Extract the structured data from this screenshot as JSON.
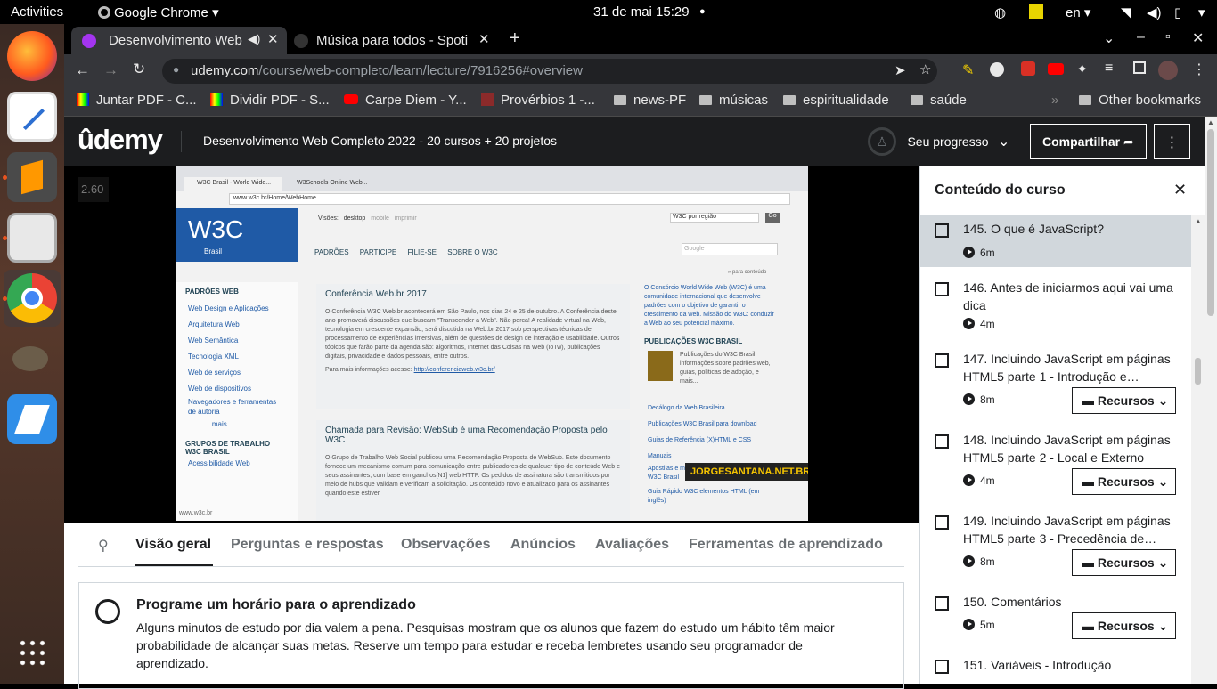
{
  "system": {
    "activities": "Activities",
    "app": "Google Chrome",
    "datetime": "31 de mai  15:29",
    "lang": "en"
  },
  "tabs": [
    {
      "title": "Desenvolvimento Web",
      "active": true
    },
    {
      "title": "Música para todos - Spoti",
      "active": false
    }
  ],
  "omnibox": {
    "host": "udemy.com",
    "path": "/course/web-completo/learn/lecture/7916256#overview"
  },
  "bookmarks": [
    "Juntar PDF - C...",
    "Dividir PDF - S...",
    "Carpe Diem - Y...",
    "Provérbios 1 -...",
    "news-PF",
    "músicas",
    "espiritualidade",
    "saúde",
    "Other bookmarks"
  ],
  "udemy": {
    "logo": "ûdemy",
    "course_title": "Desenvolvimento Web Completo 2022 - 20 cursos + 20 projetos",
    "progress_label": "Seu progresso",
    "share_label": "Compartilhar",
    "speed": "2.60"
  },
  "video": {
    "watermark": "JORGESANTANA.NET.BR",
    "tab1": "W3C Brasil - World Wide...",
    "tab2": "W3Schools Online Web...",
    "url": "www.w3c.br/Home/WebHome",
    "views_label": "Visões:",
    "views": [
      "desktop",
      "mobile",
      "imprimir"
    ],
    "region": "W3C por região",
    "go": "Go",
    "logo": "W3C",
    "logo_sub": "Brasil",
    "topnav": [
      "PADRÕES",
      "PARTICIPE",
      "FILIE-SE",
      "SOBRE O W3C"
    ],
    "search_placeholder": "Google",
    "skip": "» para conteúdo",
    "left_heading": "PADRÕES WEB",
    "left_items": [
      "Web Design e Aplicações",
      "Arquitetura Web",
      "Web Semântica",
      "Tecnologia XML",
      "Web de serviços",
      "Web de dispositivos",
      "Navegadores e ferramentas de autoria"
    ],
    "more": "... mais",
    "groups_heading": "GRUPOS DE TRABALHO W3C BRASIL",
    "groups_first": "Acessibilidade Web",
    "article1_title": "Conferência Web.br 2017",
    "article1_body": "O Conferência W3C Web.br acontecerá em São Paulo, nos dias 24 e 25 de outubro. A Conferência deste ano promoverá discussões que buscam \"Transcender a Web\". Não perca! A realidade virtual na Web, tecnologia em crescente expansão, será discutida na Web.br 2017 sob perspectivas técnicas de processamento de experiências imersivas, além de questões de design de interação e usabilidade. Outros tópicos que farão parte da agenda são: algoritmos, Internet das Coisas na Web (IoTw), publicações digitais, privacidade e dados pessoais, entre outros.",
    "article1_more": "Para mais informações acesse:",
    "article1_link": "http://conferenciaweb.w3c.br/",
    "article2_title": "Chamada para Revisão: WebSub é uma Recomendação Proposta pelo W3C",
    "article2_body": "O Grupo de Trabalho Web Social publicou uma Recomendação Proposta de WebSub. Este documento fornece um mecanismo comum para comunicação entre publicadores de qualquer tipo de conteúdo Web e seus assinantes, com base em ganchos[N1] web HTTP. Os pedidos de assinatura são transmitidos por meio de hubs que validam e verificam a solicitação. Os conteúdo novo e atualizado para os assinantes quando este estiver",
    "right_intro": "O Consórcio World Wide Web (W3C) é uma comunidade internacional que desenvolve padrões com o objetivo de garantir o crescimento da web. Missão do W3C: conduzir a Web ao seu potencial máximo.",
    "pub_heading": "PUBLICAÇÕES W3C BRASIL",
    "pub_text": "Publicações do W3C Brasil: informações sobre padrões web, guias, políticas de adoção, e mais...",
    "right_links": [
      "Decálogo da Web Brasileira",
      "Publicações W3C Brasil para download",
      "Guias de Referência (X)HTML e CSS",
      "Manuais",
      "Apostilas e materiais didáticos dos cursos W3C Brasil",
      "Guia Rápido W3C elementos HTML (em inglês)"
    ],
    "status": "www.w3c.br"
  },
  "content_tabs": [
    "Visão geral",
    "Perguntas e respostas",
    "Observações",
    "Anúncios",
    "Avaliações",
    "Ferramentas de aprendizado"
  ],
  "reminder": {
    "title": "Programe um horário para o aprendizado",
    "body": "Alguns minutos de estudo por dia valem a pena. Pesquisas mostram que os alunos que fazem do estudo um hábito têm maior probabilidade de alcançar suas metas. Reserve um tempo para estudar e receba lembretes usando seu programador de aprendizado."
  },
  "sidebar": {
    "title": "Conteúdo do curso",
    "resources_label": "Recursos",
    "items": [
      {
        "title": "145. O que é JavaScript?",
        "duration": "6m",
        "resources": false
      },
      {
        "title": "146. Antes de iniciarmos aqui vai uma dica",
        "duration": "4m",
        "resources": false
      },
      {
        "title": "147. Incluindo JavaScript em páginas HTML5 parte 1 - Introdução e…",
        "duration": "8m",
        "resources": true
      },
      {
        "title": "148. Incluindo JavaScript em páginas HTML5 parte 2 - Local e Externo",
        "duration": "4m",
        "resources": true
      },
      {
        "title": "149. Incluindo JavaScript em páginas HTML5 parte 3 - Precedência de…",
        "duration": "8m",
        "resources": true
      },
      {
        "title": "150. Comentários",
        "duration": "5m",
        "resources": true
      },
      {
        "title": "151. Variáveis - Introdução",
        "duration": "",
        "resources": false
      }
    ]
  },
  "colors": {
    "udemy_dark": "#1c1d1f",
    "accent_purple": "#a435f0",
    "highlight": "#d1d7dc"
  }
}
